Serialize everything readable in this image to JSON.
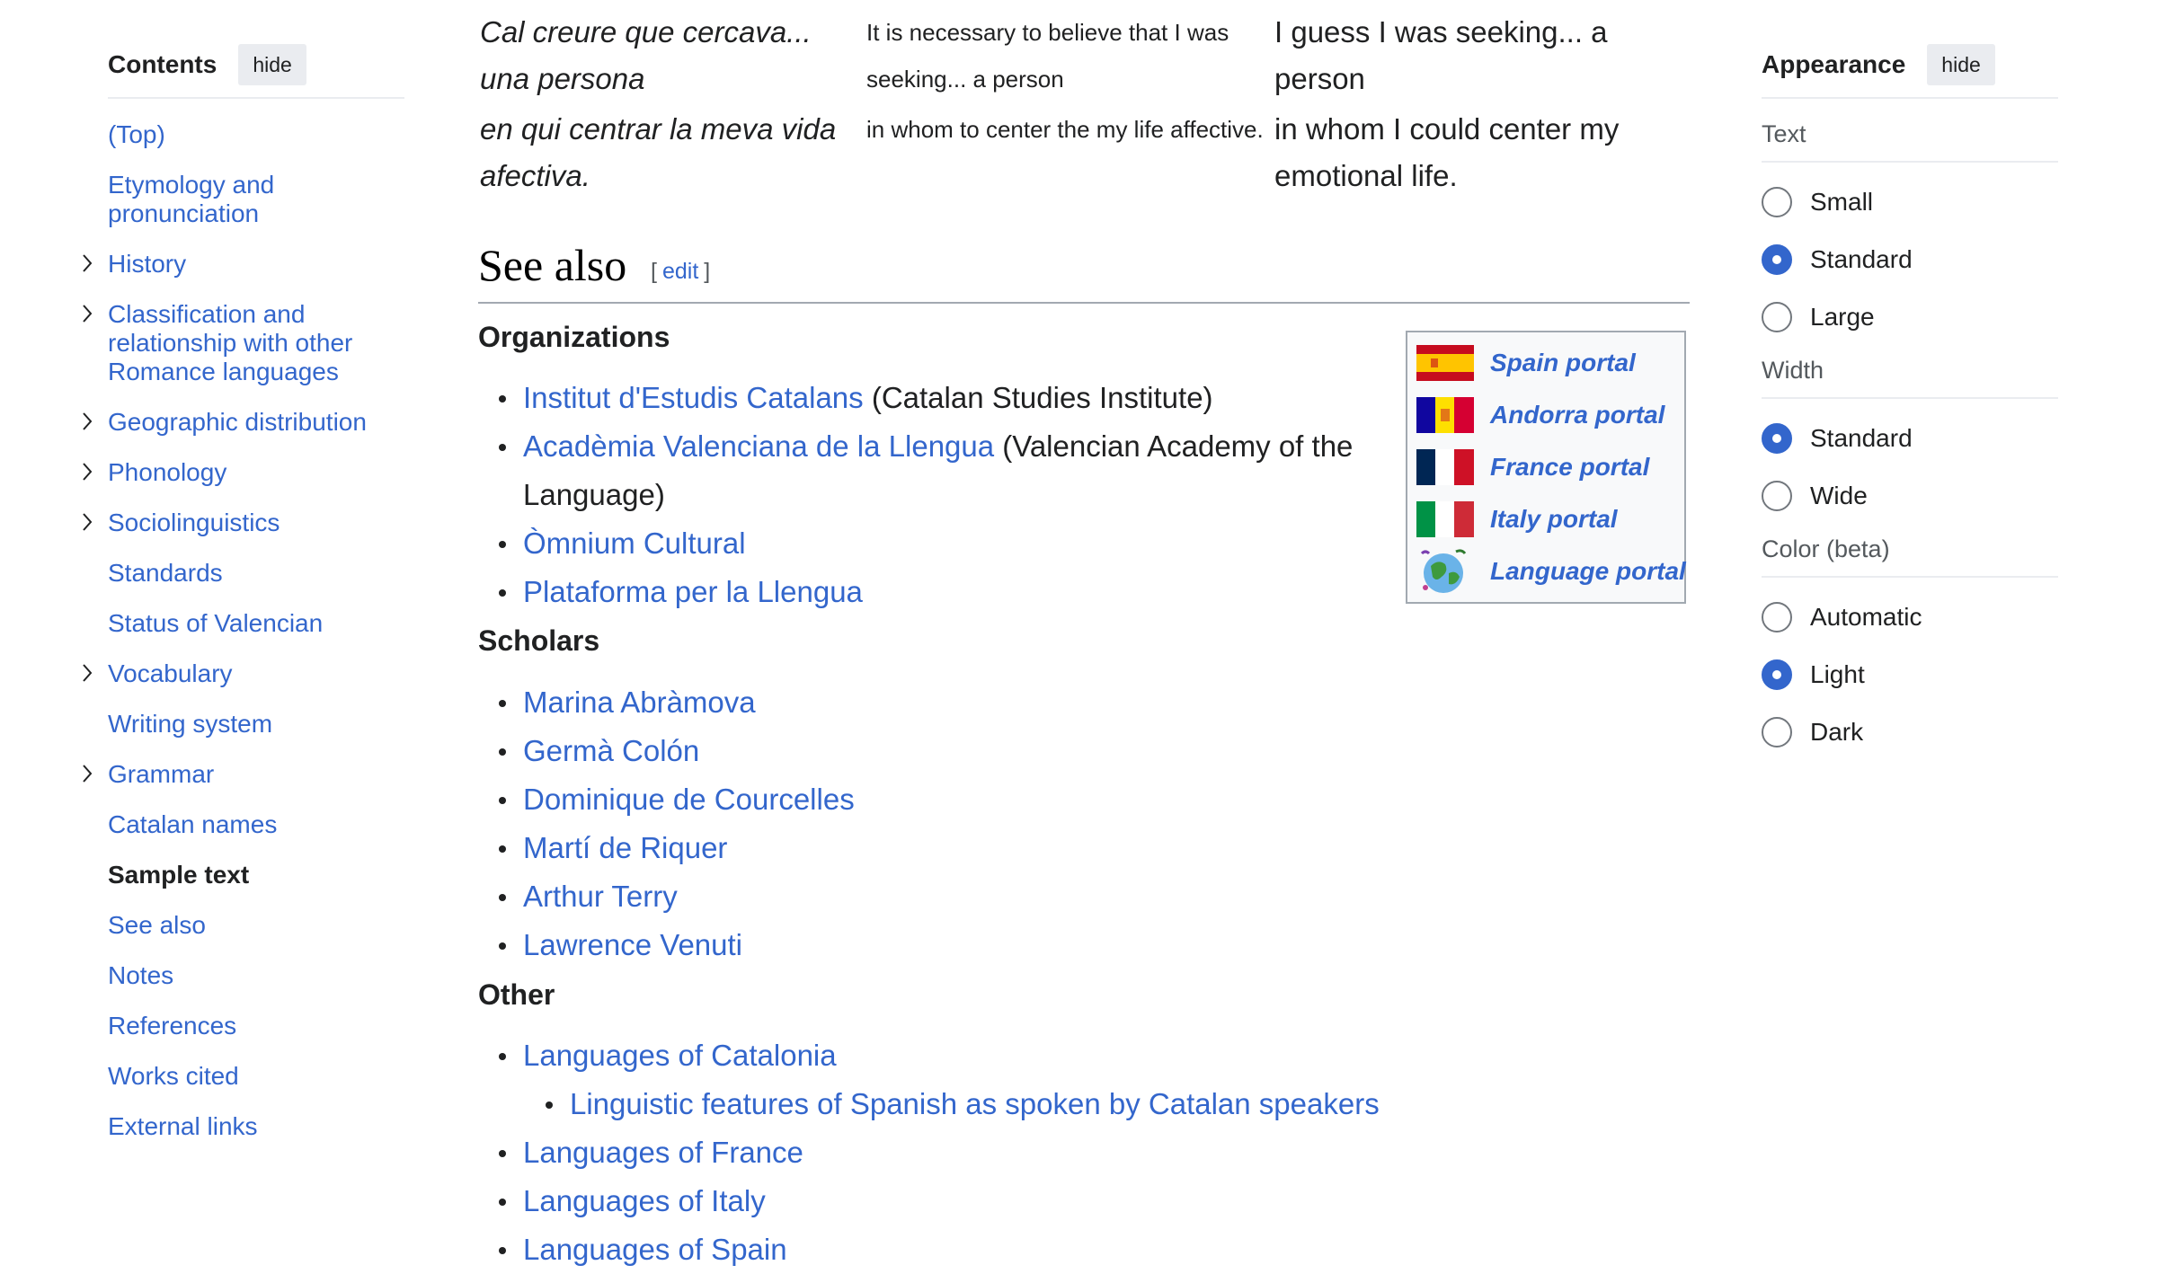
{
  "toc": {
    "title": "Contents",
    "hide_label": "hide",
    "items": [
      {
        "label": "(Top)",
        "expandable": false,
        "active": false
      },
      {
        "label": "Etymology and pronunciation",
        "expandable": false,
        "active": false
      },
      {
        "label": "History",
        "expandable": true,
        "active": false
      },
      {
        "label": "Classification and relationship with other Romance languages",
        "expandable": true,
        "active": false
      },
      {
        "label": "Geographic distribution",
        "expandable": true,
        "active": false
      },
      {
        "label": "Phonology",
        "expandable": true,
        "active": false
      },
      {
        "label": "Sociolinguistics",
        "expandable": true,
        "active": false
      },
      {
        "label": "Standards",
        "expandable": false,
        "active": false
      },
      {
        "label": "Status of Valencian",
        "expandable": false,
        "active": false
      },
      {
        "label": "Vocabulary",
        "expandable": true,
        "active": false
      },
      {
        "label": "Writing system",
        "expandable": false,
        "active": false
      },
      {
        "label": "Grammar",
        "expandable": true,
        "active": false
      },
      {
        "label": "Catalan names",
        "expandable": false,
        "active": false
      },
      {
        "label": "Sample text",
        "expandable": false,
        "active": true
      },
      {
        "label": "See also",
        "expandable": false,
        "active": false
      },
      {
        "label": "Notes",
        "expandable": false,
        "active": false
      },
      {
        "label": "References",
        "expandable": false,
        "active": false
      },
      {
        "label": "Works cited",
        "expandable": false,
        "active": false
      },
      {
        "label": "External links",
        "expandable": false,
        "active": false
      }
    ]
  },
  "sample_rows": [
    {
      "catalan": "Cal creure que cercava... una persona",
      "gloss": "It is necessary to believe that I was seeking... a person",
      "english": "I guess I was seeking... a person"
    },
    {
      "catalan": "en qui centrar la meva vida afectiva.",
      "gloss": "in whom to center the my life affective.",
      "english": "in whom I could center my emotional life."
    }
  ],
  "see_also": {
    "title": "See also",
    "edit_open": "[",
    "edit_label": "edit",
    "edit_close": "]",
    "organizations_heading": "Organizations",
    "organizations": [
      {
        "link": "Institut d'Estudis Catalans",
        "desc": " (Catalan Studies Institute)"
      },
      {
        "link": "Acadèmia Valenciana de la Llengua",
        "desc": " (Valencian Academy of the Language)"
      },
      {
        "link": "Òmnium Cultural",
        "desc": ""
      },
      {
        "link": "Plataforma per la Llengua",
        "desc": ""
      }
    ],
    "scholars_heading": "Scholars",
    "scholars": [
      "Marina Abràmova",
      "Germà Colón",
      "Dominique de Courcelles",
      "Martí de Riquer",
      "Arthur Terry",
      "Lawrence Venuti"
    ],
    "other_heading": "Other",
    "other": [
      {
        "link": "Languages of Catalonia",
        "nested": false
      },
      {
        "link": "Linguistic features of Spanish as spoken by Catalan speakers",
        "nested": true
      },
      {
        "link": "Languages of France",
        "nested": false
      },
      {
        "link": "Languages of Italy",
        "nested": false
      },
      {
        "link": "Languages of Spain",
        "nested": false
      }
    ]
  },
  "portals": [
    {
      "label": "Spain portal",
      "icon": "spain-flag-icon"
    },
    {
      "label": "Andorra portal",
      "icon": "andorra-flag-icon"
    },
    {
      "label": "France portal",
      "icon": "france-flag-icon"
    },
    {
      "label": "Italy portal",
      "icon": "italy-flag-icon"
    },
    {
      "label": "Language portal",
      "icon": "globe-icon"
    }
  ],
  "appearance": {
    "title": "Appearance",
    "hide_label": "hide",
    "groups": [
      {
        "label": "Text",
        "options": [
          {
            "label": "Small",
            "checked": false
          },
          {
            "label": "Standard",
            "checked": true
          },
          {
            "label": "Large",
            "checked": false
          }
        ]
      },
      {
        "label": "Width",
        "options": [
          {
            "label": "Standard",
            "checked": true
          },
          {
            "label": "Wide",
            "checked": false
          }
        ]
      },
      {
        "label": "Color (beta)",
        "options": [
          {
            "label": "Automatic",
            "checked": false
          },
          {
            "label": "Light",
            "checked": true
          },
          {
            "label": "Dark",
            "checked": false
          }
        ]
      }
    ]
  },
  "colors": {
    "link": "#3366cc",
    "text": "#202122",
    "accent": "#3366cc",
    "divider": "#a2a9b1"
  }
}
